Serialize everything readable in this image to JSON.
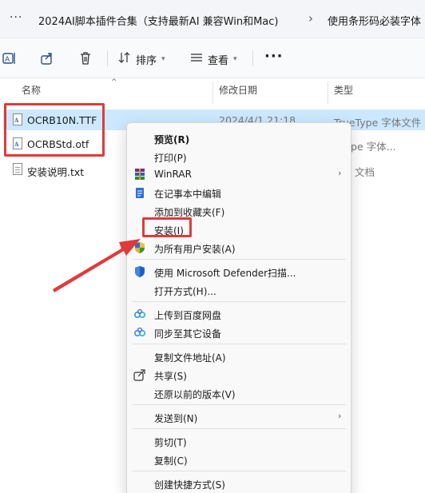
{
  "breadcrumb": {
    "more": "···",
    "items": [
      "2024AI脚本插件合集（支持最新AI 兼容Win和Mac)",
      "使用条形码必装字体"
    ],
    "separator": "›"
  },
  "toolbar": {
    "sort_label": "排序",
    "view_label": "查看",
    "more_label": "···"
  },
  "columns": {
    "name": "名称",
    "date": "修改日期",
    "type": "类型"
  },
  "files": [
    {
      "name": "OCRB10N.TTF",
      "date": "2024/4/1 21:18",
      "type": "TrueType 字体文件",
      "icon": "font-file-icon",
      "selected": true
    },
    {
      "name": "OCRBStd.otf",
      "date": "",
      "type": "nType 字体...",
      "icon": "font-file-icon",
      "selected": false
    },
    {
      "name": "安装说明.txt",
      "date": "",
      "type": "文档",
      "icon": "text-file-icon",
      "selected": false
    }
  ],
  "menu": {
    "preview": "预览(R)",
    "print": "打印(P)",
    "winrar": "WinRAR",
    "notepad": "在记事本中编辑",
    "favorites": "添加到收藏夹(F)",
    "install": "安装(I)",
    "install_all": "为所有用户安装(A)",
    "defender": "使用 Microsoft Defender扫描...",
    "open_with": "打开方式(H)...",
    "baidu_upload": "上传到百度网盘",
    "sync_devices": "同步至其它设备",
    "copy_path": "复制文件地址(A)",
    "share": "共享(S)",
    "restore": "还原以前的版本(V)",
    "send_to": "发送到(N)",
    "cut": "剪切(T)",
    "copy": "复制(C)",
    "shortcut": "创建快捷方式(S)",
    "submenu_arrow": "›"
  },
  "colors": {
    "selection": "#cce8ff",
    "annotation_red": "#e03a3a"
  }
}
